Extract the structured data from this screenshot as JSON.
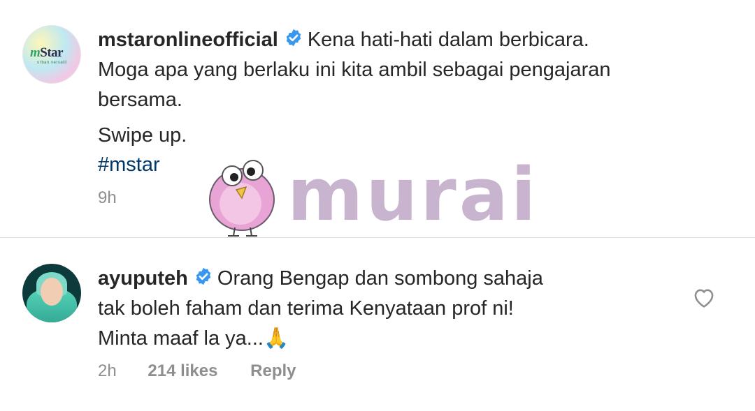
{
  "posts": [
    {
      "username": "mstaronlineofficial",
      "verified": true,
      "lines": [
        "Kena hati-hati dalam berbicara.",
        "Moga apa yang berlaku ini kita ambil sebagai pengajaran",
        "bersama."
      ],
      "extra_line": "Swipe up.",
      "hashtag": "#mstar",
      "time": "9h",
      "avatar_logo_text": "Star",
      "avatar_logo_prefix": "m",
      "avatar_logo_sub": "urban.versatil"
    },
    {
      "username": "ayuputeh",
      "verified": true,
      "lines": [
        "Orang Bengap dan sombong sahaja",
        "tak boleh faham dan terima Kenyataan prof ni!",
        "Minta maaf la ya..."
      ],
      "emoji": "🙏",
      "time": "2h",
      "likes": "214 likes",
      "reply": "Reply"
    }
  ],
  "watermark": {
    "text": "murai",
    "color": "#c9b4cf"
  },
  "colors": {
    "text": "#262626",
    "meta": "#8e8e8e",
    "hashtag": "#00376b",
    "verified": "#3897f0",
    "divider": "#dbdbdb"
  },
  "icons": {
    "verified": "verified-badge-icon",
    "like": "heart-outline-icon"
  }
}
